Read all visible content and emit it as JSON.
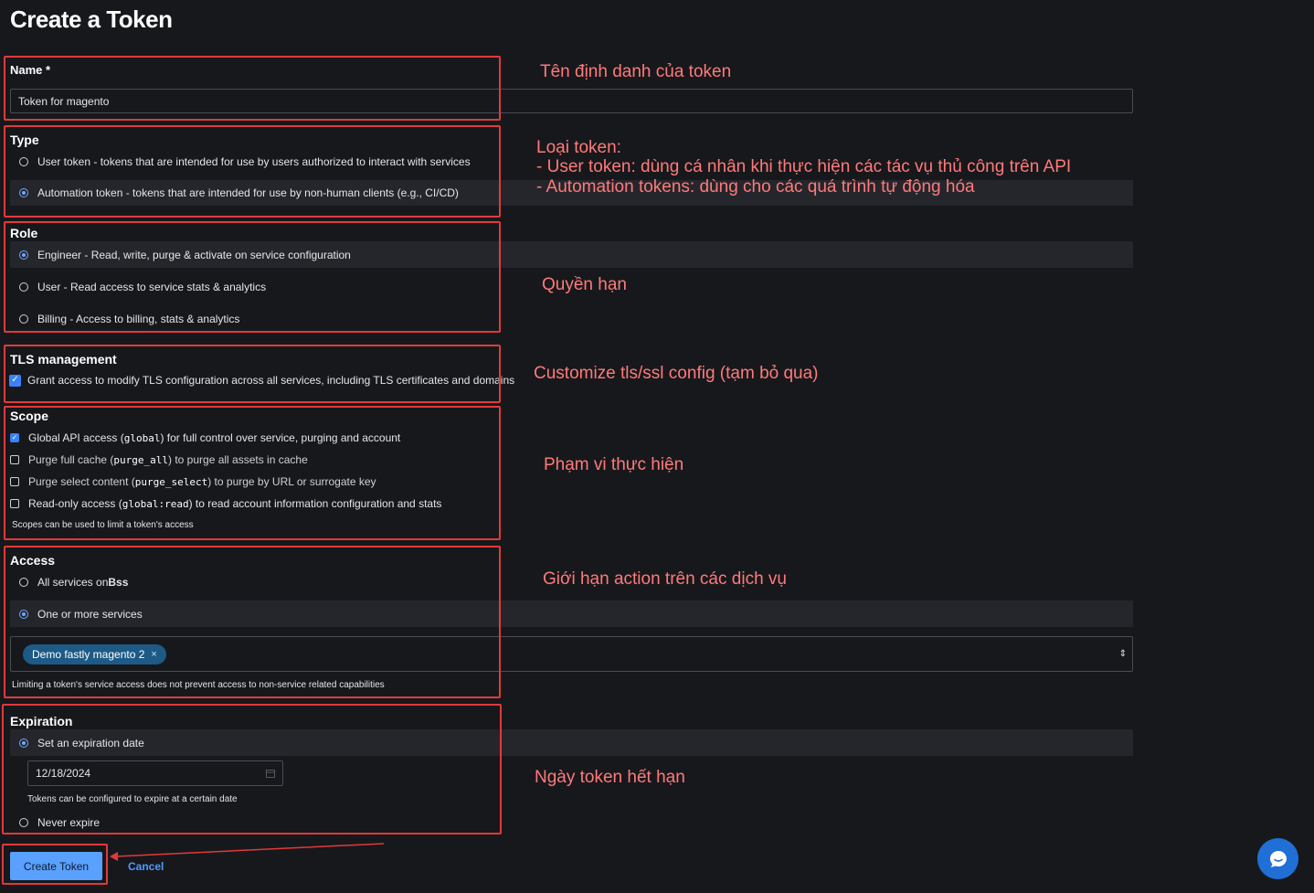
{
  "page": {
    "title": "Create a Token"
  },
  "name_section": {
    "label": "Name *",
    "value": "Token for magento"
  },
  "type_section": {
    "label": "Type",
    "options": [
      "User token - tokens that are intended for use by users authorized to interact with services",
      "Automation token - tokens that are intended for use by non-human clients (e.g., CI/CD)"
    ],
    "selected": 1
  },
  "role_section": {
    "label": "Role",
    "options": [
      "Engineer - Read, write, purge & activate on service configuration",
      "User - Read access to service stats & analytics",
      "Billing - Access to billing, stats & analytics"
    ],
    "selected": 0
  },
  "tls_section": {
    "label": "TLS management",
    "checkbox_label": "Grant access to modify TLS configuration across all services, including TLS certificates and domains",
    "checked": true
  },
  "scope_section": {
    "label": "Scope",
    "items": [
      {
        "pre": "Global API access (",
        "code": "global",
        "post": ") for full control over service, purging and account",
        "checked": true
      },
      {
        "pre": "Purge full cache (",
        "code": "purge_all",
        "post": ") to purge all assets in cache",
        "checked": false
      },
      {
        "pre": "Purge select content (",
        "code": "purge_select",
        "post": ") to purge by URL or surrogate key",
        "checked": false
      },
      {
        "pre": "Read-only access (",
        "code": "global:read",
        "post": ") to read account information configuration and stats",
        "checked": false
      }
    ],
    "hint": "Scopes can be used to limit a token's access"
  },
  "access_section": {
    "label": "Access",
    "all_services_prefix": "All services on ",
    "all_services_account": "Bss",
    "one_or_more_label": "One or more services",
    "selected": 1,
    "chips": [
      {
        "label": "Demo fastly magento 2",
        "remove": "×"
      }
    ],
    "select_arrow": "⇕",
    "hint": "Limiting a token's service access does not prevent access to non-service related capabilities"
  },
  "expiration_section": {
    "label": "Expiration",
    "set_date_label": "Set an expiration date",
    "date_value": "12/18/2024",
    "date_hint": "Tokens can be configured to expire at a certain date",
    "never_label": "Never expire",
    "selected": 0
  },
  "actions": {
    "create_label": "Create Token",
    "cancel_label": "Cancel"
  },
  "annotations": {
    "name": "Tên định danh của token",
    "type_lines": [
      "Loại token:",
      "- User token: dùng cá nhân khi thực hiện các tác vụ thủ công trên API",
      "- Automation tokens: dùng cho các quá trình tự động hóa"
    ],
    "role": "Quyền hạn",
    "tls": "Customize tls/ssl config (tạm bỏ qua)",
    "scope": "Phạm vi thực hiện",
    "access": "Giới hạn action trên các dịch vụ",
    "expiration": "Ngày token hết hạn"
  },
  "colors": {
    "background": "#17181c",
    "annotation_red": "#e03a3a",
    "primary_button": "#5aa0ff",
    "chip": "#1d5a86"
  }
}
